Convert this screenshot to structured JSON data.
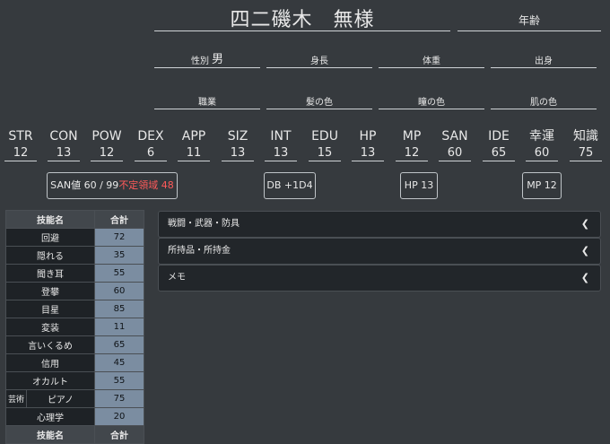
{
  "profile": {
    "name": "四二磯木　無様",
    "age_label": "年齢",
    "gender_label": "性別",
    "gender_value": "男",
    "height_label": "身長",
    "weight_label": "体重",
    "birthplace_label": "出身",
    "occupation_label": "職業",
    "hair_label": "髪の色",
    "eye_label": "瞳の色",
    "skin_label": "肌の色"
  },
  "stats": [
    {
      "label": "STR",
      "value": "12"
    },
    {
      "label": "CON",
      "value": "13"
    },
    {
      "label": "POW",
      "value": "12"
    },
    {
      "label": "DEX",
      "value": "6"
    },
    {
      "label": "APP",
      "value": "11"
    },
    {
      "label": "SIZ",
      "value": "13"
    },
    {
      "label": "INT",
      "value": "13"
    },
    {
      "label": "EDU",
      "value": "15"
    },
    {
      "label": "HP",
      "value": "13"
    },
    {
      "label": "MP",
      "value": "12"
    },
    {
      "label": "SAN",
      "value": "60"
    },
    {
      "label": "IDE",
      "value": "65"
    },
    {
      "label": "幸運",
      "value": "60"
    },
    {
      "label": "知識",
      "value": "75"
    }
  ],
  "badges": {
    "san_text": "SAN値 60 / 99",
    "san_indef": "不定領域 48",
    "db": "DB +1D4",
    "hp": "HP 13",
    "mp": "MP 12"
  },
  "skills": {
    "header_name": "技能名",
    "header_total": "合計",
    "rows": [
      {
        "name": "回避",
        "value": "72"
      },
      {
        "name": "隠れる",
        "value": "35"
      },
      {
        "name": "聞き耳",
        "value": "55"
      },
      {
        "name": "登攀",
        "value": "60"
      },
      {
        "name": "目星",
        "value": "85"
      },
      {
        "name": "変装",
        "value": "11"
      },
      {
        "name": "言いくるめ",
        "value": "65"
      },
      {
        "name": "信用",
        "value": "45"
      },
      {
        "name": "オカルト",
        "value": "55"
      }
    ],
    "art": {
      "category": "芸術",
      "name": "ピアノ",
      "value": "75"
    },
    "last": {
      "name": "心理学",
      "value": "20"
    }
  },
  "panels": [
    {
      "title": "戦闘・武器・防具"
    },
    {
      "title": "所持品・所持金"
    },
    {
      "title": "メモ"
    }
  ],
  "icons": {
    "collapse": "chevron-left-icon"
  }
}
